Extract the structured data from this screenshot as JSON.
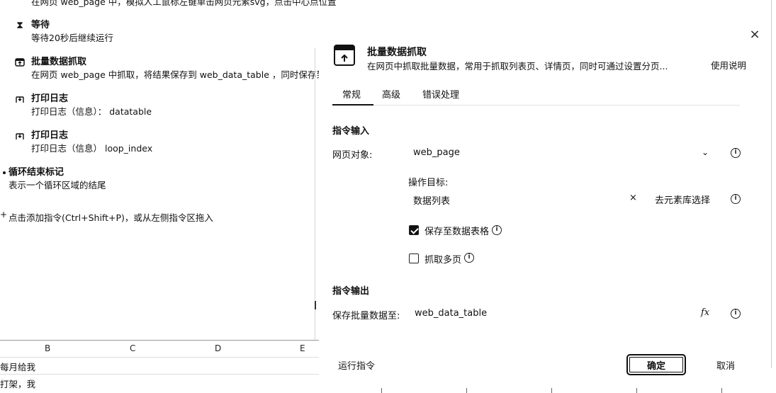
{
  "commands": [
    {
      "desc": "在网页 web_page 中，模拟人工鼠标左键单击网页元素svg，点击中心点位置"
    },
    {
      "title": "等待",
      "desc": "等待20秒后继续运行",
      "icon": "hourglass-icon"
    },
    {
      "title": "批量数据抓取",
      "desc": "在网页 web_page 中抓取，将结果保存到 web_data_table ，同时保存到数",
      "icon": "batch-scrape-icon"
    },
    {
      "title": "打印日志",
      "desc": "打印日志（信息）：  datatable",
      "icon": "log-icon"
    },
    {
      "title": "打印日志",
      "desc": "打印日志（信息）    loop_index",
      "icon": "log-icon"
    },
    {
      "title": "循环结束标记",
      "desc": "表示一个循环区域的结尾"
    }
  ],
  "add_hint": "点击添加指令(Ctrl+Shift+P)，或从左侧指令区拖入",
  "sheet": {
    "columns": [
      "B",
      "C",
      "D",
      "E"
    ],
    "rows": [
      "每月给我",
      "打架，我"
    ]
  },
  "dialog": {
    "title": "批量数据抓取",
    "subtitle": "在网页中抓取批量数据，常用于抓取列表页、详情页，同时可通过设置分页...",
    "usage_link": "使用说明",
    "tabs": [
      "常规",
      "高级",
      "错误处理"
    ],
    "input_section": "指令输入",
    "web_object_label": "网页对象:",
    "web_object_value": "web_page",
    "target_label": "操作目标:",
    "target_value": "数据列表",
    "pick_element_label": "去元素库选择",
    "save_to_table_label": "保存至数据表格",
    "save_to_table_checked": true,
    "multi_page_label": "抓取多页",
    "multi_page_checked": false,
    "output_section": "指令输出",
    "save_output_label": "保存批量数据至:",
    "save_output_value": "web_data_table",
    "fx_label": "fx",
    "run_label": "运行指令",
    "ok_label": "确定",
    "cancel_label": "取消"
  }
}
